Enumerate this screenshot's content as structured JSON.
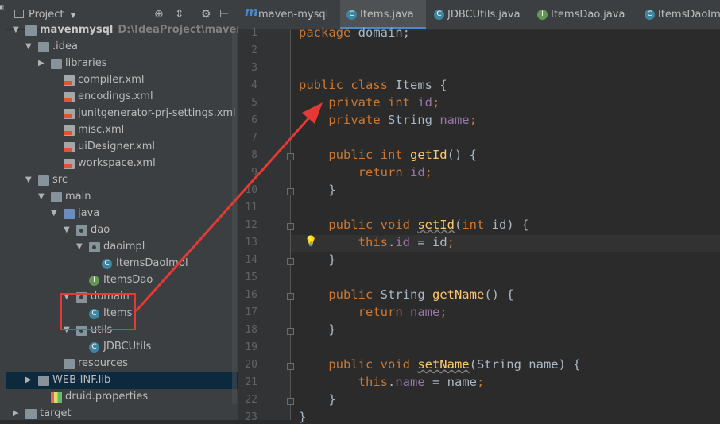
{
  "project_panel": {
    "title": "Project",
    "tree": [
      {
        "label": "mavenmysql",
        "sub": "D:\\IdeaProject\\mavenmysql",
        "icon": "folder",
        "arrow": "▼"
      },
      {
        "label": ".idea",
        "icon": "folder",
        "arrow": "▼"
      },
      {
        "label": "libraries",
        "icon": "folder",
        "arrow": "▶"
      },
      {
        "label": "compiler.xml",
        "icon": "xml"
      },
      {
        "label": "encodings.xml",
        "icon": "xml"
      },
      {
        "label": "junitgenerator-prj-settings.xml",
        "icon": "xml"
      },
      {
        "label": "misc.xml",
        "icon": "xml"
      },
      {
        "label": "uiDesigner.xml",
        "icon": "xml"
      },
      {
        "label": "workspace.xml",
        "icon": "xml"
      },
      {
        "label": "src",
        "icon": "folder",
        "arrow": "▼"
      },
      {
        "label": "main",
        "icon": "folder",
        "arrow": "▼"
      },
      {
        "label": "java",
        "icon": "folder-blue",
        "arrow": "▼"
      },
      {
        "label": "dao",
        "icon": "package",
        "arrow": "▼"
      },
      {
        "label": "daoimpl",
        "icon": "package",
        "arrow": "▼"
      },
      {
        "label": "ItemsDaoImpl",
        "icon": "class"
      },
      {
        "label": "ItemsDao",
        "icon": "interface"
      },
      {
        "label": "domain",
        "icon": "package",
        "arrow": "▼"
      },
      {
        "label": "Items",
        "icon": "class"
      },
      {
        "label": "utils",
        "icon": "package",
        "arrow": "▼"
      },
      {
        "label": "JDBCUtils",
        "icon": "class"
      },
      {
        "label": "resources",
        "icon": "folder"
      },
      {
        "label": "WEB-INF.lib",
        "icon": "folder",
        "arrow": "▶"
      },
      {
        "label": "druid.properties",
        "icon": "properties"
      },
      {
        "label": "target",
        "icon": "folder",
        "arrow": "▶"
      }
    ]
  },
  "tabs": [
    {
      "label": "maven-mysql",
      "icon": "m",
      "active": false
    },
    {
      "label": "Items.java",
      "icon": "C",
      "active": true
    },
    {
      "label": "JDBCUtils.java",
      "icon": "C",
      "active": false
    },
    {
      "label": "ItemsDao.java",
      "icon": "I",
      "active": false
    },
    {
      "label": "ItemsDaoImp",
      "icon": "C",
      "active": false
    }
  ],
  "editor": {
    "line_numbers": [
      "1",
      "2",
      "3",
      "4",
      "5",
      "6",
      "7",
      "8",
      "9",
      "10",
      "11",
      "12",
      "13",
      "14",
      "15",
      "16",
      "17",
      "18",
      "19",
      "20",
      "21",
      "22",
      "23"
    ],
    "lines": [
      [
        [
          "kw",
          "package "
        ],
        [
          "t",
          "domain;"
        ]
      ],
      [],
      [],
      [
        [
          "kw",
          "public class "
        ],
        [
          "t",
          "Items {"
        ]
      ],
      [
        [
          "t",
          "    "
        ],
        [
          "kw",
          "private int "
        ],
        [
          "fld",
          "id"
        ],
        [
          "kw",
          ";"
        ]
      ],
      [
        [
          "t",
          "    "
        ],
        [
          "kw",
          "private "
        ],
        [
          "t",
          "String "
        ],
        [
          "fld",
          "name"
        ],
        [
          "kw",
          ";"
        ]
      ],
      [],
      [
        [
          "t",
          "    "
        ],
        [
          "kw",
          "public int "
        ],
        [
          "fn",
          "getId"
        ],
        [
          "t",
          "() {"
        ]
      ],
      [
        [
          "t",
          "        "
        ],
        [
          "kw",
          "return "
        ],
        [
          "fld",
          "id"
        ],
        [
          "kw",
          ";"
        ]
      ],
      [
        [
          "t",
          "    }"
        ]
      ],
      [],
      [
        [
          "t",
          "    "
        ],
        [
          "kw",
          "public void "
        ],
        [
          "fnu",
          "setId"
        ],
        [
          "t",
          "("
        ],
        [
          "kw",
          "int "
        ],
        [
          "t",
          "id) {"
        ]
      ],
      [
        [
          "t",
          "        "
        ],
        [
          "kw",
          "this"
        ],
        [
          "t",
          "."
        ],
        [
          "fld",
          "id"
        ],
        [
          "t",
          " = id"
        ],
        [
          "kw",
          ";"
        ]
      ],
      [
        [
          "t",
          "    }"
        ]
      ],
      [],
      [
        [
          "t",
          "    "
        ],
        [
          "kw",
          "public "
        ],
        [
          "t",
          "String "
        ],
        [
          "fn",
          "getName"
        ],
        [
          "t",
          "() {"
        ]
      ],
      [
        [
          "t",
          "        "
        ],
        [
          "kw",
          "return "
        ],
        [
          "fld",
          "name"
        ],
        [
          "kw",
          ";"
        ]
      ],
      [
        [
          "t",
          "    }"
        ]
      ],
      [],
      [
        [
          "t",
          "    "
        ],
        [
          "kw",
          "public void "
        ],
        [
          "fnu",
          "setName"
        ],
        [
          "t",
          "(String name) {"
        ]
      ],
      [
        [
          "t",
          "        "
        ],
        [
          "kw",
          "this"
        ],
        [
          "t",
          "."
        ],
        [
          "fld",
          "name"
        ],
        [
          "t",
          " = name"
        ],
        [
          "kw",
          ";"
        ]
      ],
      [
        [
          "t",
          "    }"
        ]
      ],
      [
        [
          "t",
          "}"
        ]
      ]
    ]
  },
  "colors": {
    "keyword": "#cc7832",
    "field": "#9876aa",
    "method": "#ffc66d",
    "text": "#a9b7c6",
    "annotation": "#e53935"
  }
}
